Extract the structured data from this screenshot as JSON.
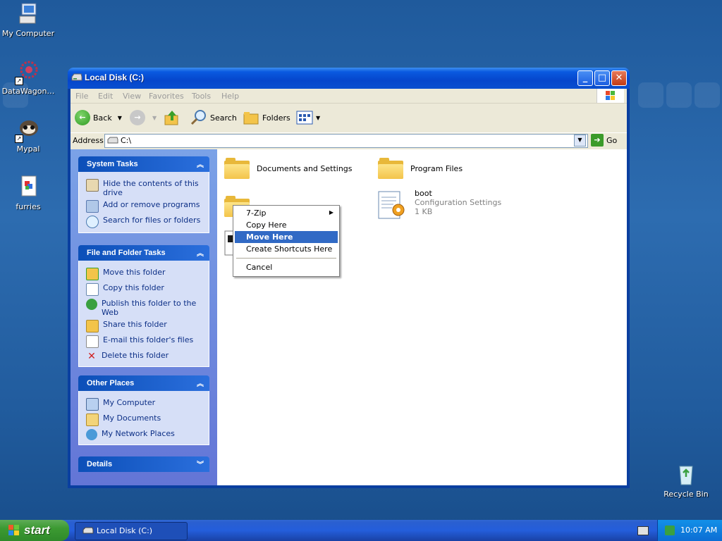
{
  "desktop": {
    "icons": [
      {
        "label": "My Computer",
        "icon": "my-computer-icon"
      },
      {
        "label": "DataWagon…",
        "icon": "datawagon-shortcut-icon"
      },
      {
        "label": "Mypal",
        "icon": "mypal-shortcut-icon"
      },
      {
        "label": "furries",
        "icon": "document-icon"
      },
      {
        "label": "Recycle Bin",
        "icon": "recycle-bin-icon"
      }
    ]
  },
  "window": {
    "title": "Local Disk (C:)",
    "menu": [
      "File",
      "Edit",
      "View",
      "Favorites",
      "Tools",
      "Help"
    ],
    "toolbar": {
      "back": "Back",
      "search": "Search",
      "folders": "Folders"
    },
    "address": {
      "label": "Address",
      "value": "C:\\",
      "go": "Go"
    },
    "panels": {
      "system_tasks": {
        "title": "System Tasks",
        "items": [
          "Hide the contents of this drive",
          "Add or remove programs",
          "Search for files or folders"
        ]
      },
      "file_folder_tasks": {
        "title": "File and Folder Tasks",
        "items": [
          "Move this folder",
          "Copy this folder",
          "Publish this folder to the Web",
          "Share this folder",
          "E-mail this folder's files",
          "Delete this folder"
        ]
      },
      "other_places": {
        "title": "Other Places",
        "items": [
          "My Computer",
          "My Documents",
          "My Network Places"
        ]
      },
      "details": {
        "title": "Details"
      }
    },
    "files": [
      {
        "name": "Documents and Settings",
        "type": "folder"
      },
      {
        "name": "Program Files",
        "type": "folder"
      },
      {
        "name": "boot",
        "type": "Configuration Settings",
        "size": "1 KB"
      }
    ]
  },
  "context_menu": {
    "items": [
      "7-Zip",
      "Copy Here",
      "Move Here",
      "Create Shortcuts Here",
      "Cancel"
    ],
    "selected": "Move Here"
  },
  "taskbar": {
    "start": "start",
    "task": "Local Disk (C:)",
    "clock": "10:07 AM"
  }
}
